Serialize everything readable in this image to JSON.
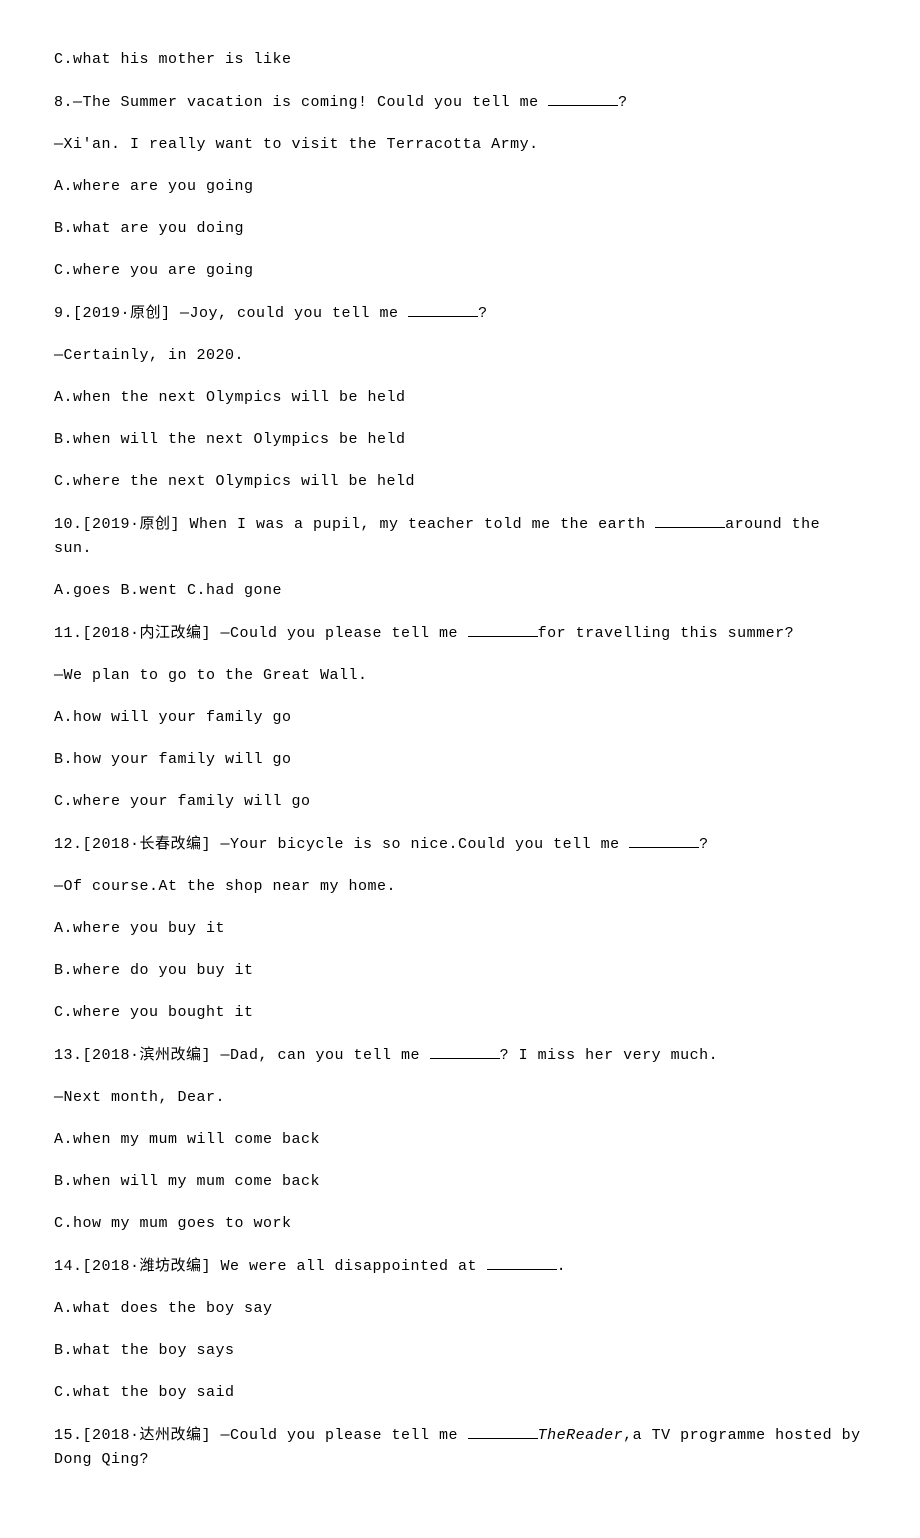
{
  "q7": {
    "optC": "C.what his mother is like"
  },
  "q8": {
    "prompt_pre": "8.—The Summer vacation is coming! Could you tell me ",
    "prompt_post": "?",
    "response": "—Xi'an. I really want to visit the Terracotta Army.",
    "optA": "A.where are you going",
    "optB": "B.what are you doing",
    "optC": "C.where you are going"
  },
  "q9": {
    "prompt_pre": "9.[2019·原创] —Joy, could you tell me ",
    "prompt_post": "?",
    "response": "—Certainly, in 2020.",
    "optA": "A.when the next Olympics will be held",
    "optB": "B.when will the next Olympics be held",
    "optC": "C.where the next Olympics will be held"
  },
  "q10": {
    "prompt_pre": "10.[2019·原创] When I was a pupil, my teacher told me the earth ",
    "prompt_post": "around the sun.",
    "opts": "A.goes  B.went  C.had gone"
  },
  "q11": {
    "prompt_pre": "11.[2018·内江改编] —Could you please tell me ",
    "prompt_post": "for travelling this summer?",
    "response": "—We plan to go to the Great Wall.",
    "optA": "A.how will your family go",
    "optB": "B.how your family will go",
    "optC": "C.where your family will go"
  },
  "q12": {
    "prompt_pre": "12.[2018·长春改编] —Your bicycle is so nice.Could you tell me ",
    "prompt_post": "?",
    "response": "—Of course.At the shop near my home.",
    "optA": "A.where you buy it",
    "optB": "B.where do you buy it",
    "optC": "C.where you bought it"
  },
  "q13": {
    "prompt_pre": "13.[2018·滨州改编] —Dad, can you tell me ",
    "prompt_post": "? I miss her very much.",
    "response": "—Next month, Dear.",
    "optA": "A.when my mum will come back",
    "optB": "B.when will my mum come back",
    "optC": "C.how my mum goes to work"
  },
  "q14": {
    "prompt_pre": "14.[2018·潍坊改编] We were all disappointed at ",
    "prompt_post": ".",
    "optA": "A.what does the boy say",
    "optB": "B.what the boy says",
    "optC": "C.what the boy said"
  },
  "q15": {
    "prompt_pre": "15.[2018·达州改编] —Could you please tell me ",
    "italic": "TheReader",
    "prompt_post": ",a TV programme hosted by Dong Qing?"
  }
}
